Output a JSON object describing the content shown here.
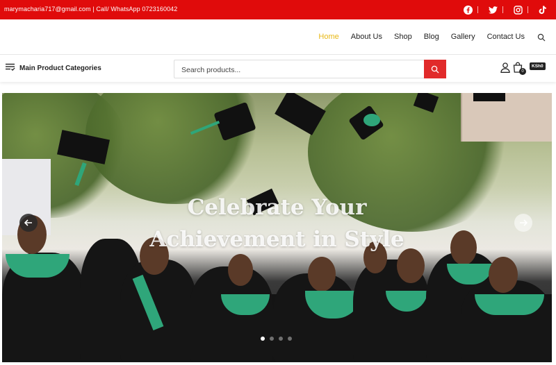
{
  "topbar": {
    "contact_text": "marymacharia717@gmail.com | Call/ WhatsApp 0723160042",
    "social_icons": [
      "facebook-icon",
      "twitter-icon",
      "instagram-icon",
      "tiktok-icon"
    ]
  },
  "nav": {
    "items": [
      {
        "label": "Home",
        "active": true
      },
      {
        "label": "About Us"
      },
      {
        "label": "Shop"
      },
      {
        "label": "Blog"
      },
      {
        "label": "Gallery"
      },
      {
        "label": "Contact Us"
      }
    ]
  },
  "catbar": {
    "categories_label": "Main Product Categories",
    "search_placeholder": "Search products...",
    "cart_count": "0",
    "currency": "KSh0"
  },
  "hero": {
    "title_line1": "Celebrate Your",
    "title_line2": "Achievement in Style",
    "slides": 4,
    "active_slide": 1
  },
  "colors": {
    "topbar": "#e00b0b",
    "nav_active": "#e8b814",
    "search_button": "#e12a2a"
  }
}
